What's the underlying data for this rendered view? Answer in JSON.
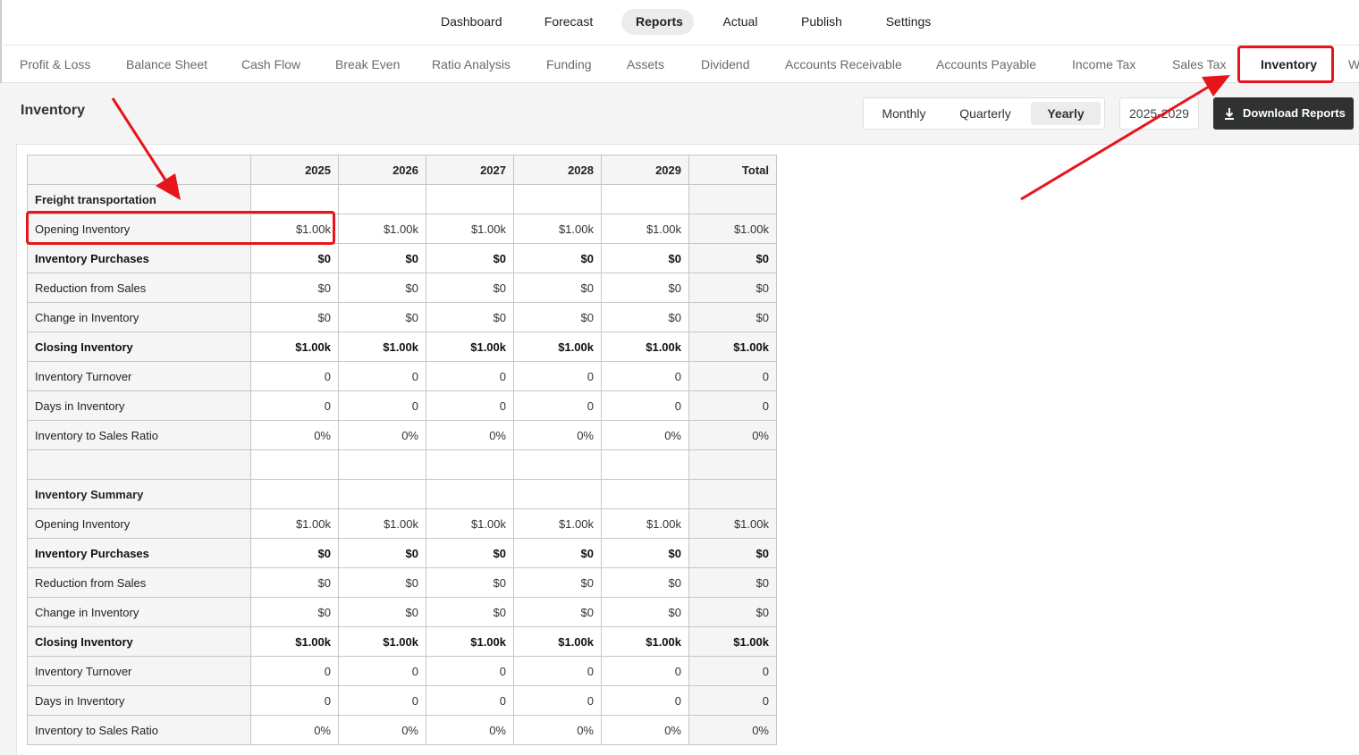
{
  "top_nav": {
    "items": [
      "Dashboard",
      "Forecast",
      "Reports",
      "Actual",
      "Publish",
      "Settings"
    ],
    "active": "Reports"
  },
  "sub_nav": {
    "tabs": [
      "Profit & Loss",
      "Balance Sheet",
      "Cash Flow",
      "Break Even",
      "Ratio Analysis",
      "Funding",
      "Assets",
      "Dividend",
      "Accounts Receivable",
      "Accounts Payable",
      "Income Tax",
      "Sales Tax",
      "Inventory",
      "W"
    ],
    "active": "Inventory"
  },
  "page": {
    "title": "Inventory",
    "period_options": [
      "Monthly",
      "Quarterly",
      "Yearly"
    ],
    "active_period": "Yearly",
    "year_range": "2025-2029",
    "download_label": "Download Reports"
  },
  "table": {
    "columns": [
      "2025",
      "2026",
      "2027",
      "2028",
      "2029",
      "Total"
    ],
    "rows": [
      {
        "label": "Freight transportation",
        "type": "section",
        "values": [
          "",
          "",
          "",
          "",
          "",
          ""
        ]
      },
      {
        "label": "Opening Inventory",
        "type": "normal",
        "values": [
          "$1.00k",
          "$1.00k",
          "$1.00k",
          "$1.00k",
          "$1.00k",
          "$1.00k"
        ]
      },
      {
        "label": "Inventory Purchases",
        "type": "bold",
        "values": [
          "$0",
          "$0",
          "$0",
          "$0",
          "$0",
          "$0"
        ]
      },
      {
        "label": "Reduction from Sales",
        "type": "normal",
        "values": [
          "$0",
          "$0",
          "$0",
          "$0",
          "$0",
          "$0"
        ]
      },
      {
        "label": "Change in Inventory",
        "type": "normal",
        "values": [
          "$0",
          "$0",
          "$0",
          "$0",
          "$0",
          "$0"
        ]
      },
      {
        "label": "Closing Inventory",
        "type": "bold",
        "values": [
          "$1.00k",
          "$1.00k",
          "$1.00k",
          "$1.00k",
          "$1.00k",
          "$1.00k"
        ]
      },
      {
        "label": "Inventory Turnover",
        "type": "normal",
        "values": [
          "0",
          "0",
          "0",
          "0",
          "0",
          "0"
        ]
      },
      {
        "label": "Days in Inventory",
        "type": "normal",
        "values": [
          "0",
          "0",
          "0",
          "0",
          "0",
          "0"
        ]
      },
      {
        "label": "Inventory to Sales Ratio",
        "type": "normal",
        "values": [
          "0%",
          "0%",
          "0%",
          "0%",
          "0%",
          "0%"
        ]
      },
      {
        "label": "",
        "type": "blank",
        "values": [
          "",
          "",
          "",
          "",
          "",
          ""
        ]
      },
      {
        "label": "Inventory Summary",
        "type": "section",
        "values": [
          "",
          "",
          "",
          "",
          "",
          ""
        ]
      },
      {
        "label": "Opening Inventory",
        "type": "normal",
        "values": [
          "$1.00k",
          "$1.00k",
          "$1.00k",
          "$1.00k",
          "$1.00k",
          "$1.00k"
        ]
      },
      {
        "label": "Inventory Purchases",
        "type": "bold",
        "values": [
          "$0",
          "$0",
          "$0",
          "$0",
          "$0",
          "$0"
        ]
      },
      {
        "label": "Reduction from Sales",
        "type": "normal",
        "values": [
          "$0",
          "$0",
          "$0",
          "$0",
          "$0",
          "$0"
        ]
      },
      {
        "label": "Change in Inventory",
        "type": "normal",
        "values": [
          "$0",
          "$0",
          "$0",
          "$0",
          "$0",
          "$0"
        ]
      },
      {
        "label": "Closing Inventory",
        "type": "bold",
        "values": [
          "$1.00k",
          "$1.00k",
          "$1.00k",
          "$1.00k",
          "$1.00k",
          "$1.00k"
        ]
      },
      {
        "label": "Inventory Turnover",
        "type": "normal",
        "values": [
          "0",
          "0",
          "0",
          "0",
          "0",
          "0"
        ]
      },
      {
        "label": "Days in Inventory",
        "type": "normal",
        "values": [
          "0",
          "0",
          "0",
          "0",
          "0",
          "0"
        ]
      },
      {
        "label": "Inventory to Sales Ratio",
        "type": "normal",
        "values": [
          "0%",
          "0%",
          "0%",
          "0%",
          "0%",
          "0%"
        ]
      }
    ]
  },
  "icons": {
    "download": "download-icon"
  },
  "colors": {
    "annotation": "#e8141b",
    "download_button_bg": "#2f3133"
  }
}
